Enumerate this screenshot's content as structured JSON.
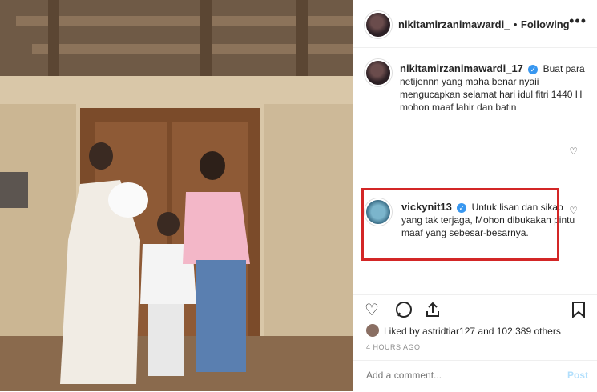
{
  "header": {
    "username": "nikitamirzanimawardi_",
    "separator": "•",
    "follow_status": "Following",
    "more_label": "•••"
  },
  "caption": {
    "username": "nikitamirzanimawardi_17",
    "text": "Buat para netijennn yang maha benar nyaii mengucapkan selamat hari idul fitri 1440 H mohon maaf lahir dan batin"
  },
  "comment": {
    "username": "vickynit13",
    "text": "Untuk lisan dan sikap yang tak terjaga, Mohon dibukakan pintu maaf yang sebesar-besarnya."
  },
  "likes": {
    "text": "Liked by astridtiar127 and 102,389 others"
  },
  "timestamp": "4 HOURS AGO",
  "add_comment": {
    "placeholder": "Add a comment...",
    "post_label": "Post"
  },
  "colors": {
    "verified": "#3897f0",
    "highlight": "#d32626",
    "post": "#b2dffc"
  },
  "icons": [
    "heart-icon",
    "comment-icon",
    "share-icon",
    "bookmark-icon",
    "verified-icon",
    "more-icon"
  ]
}
